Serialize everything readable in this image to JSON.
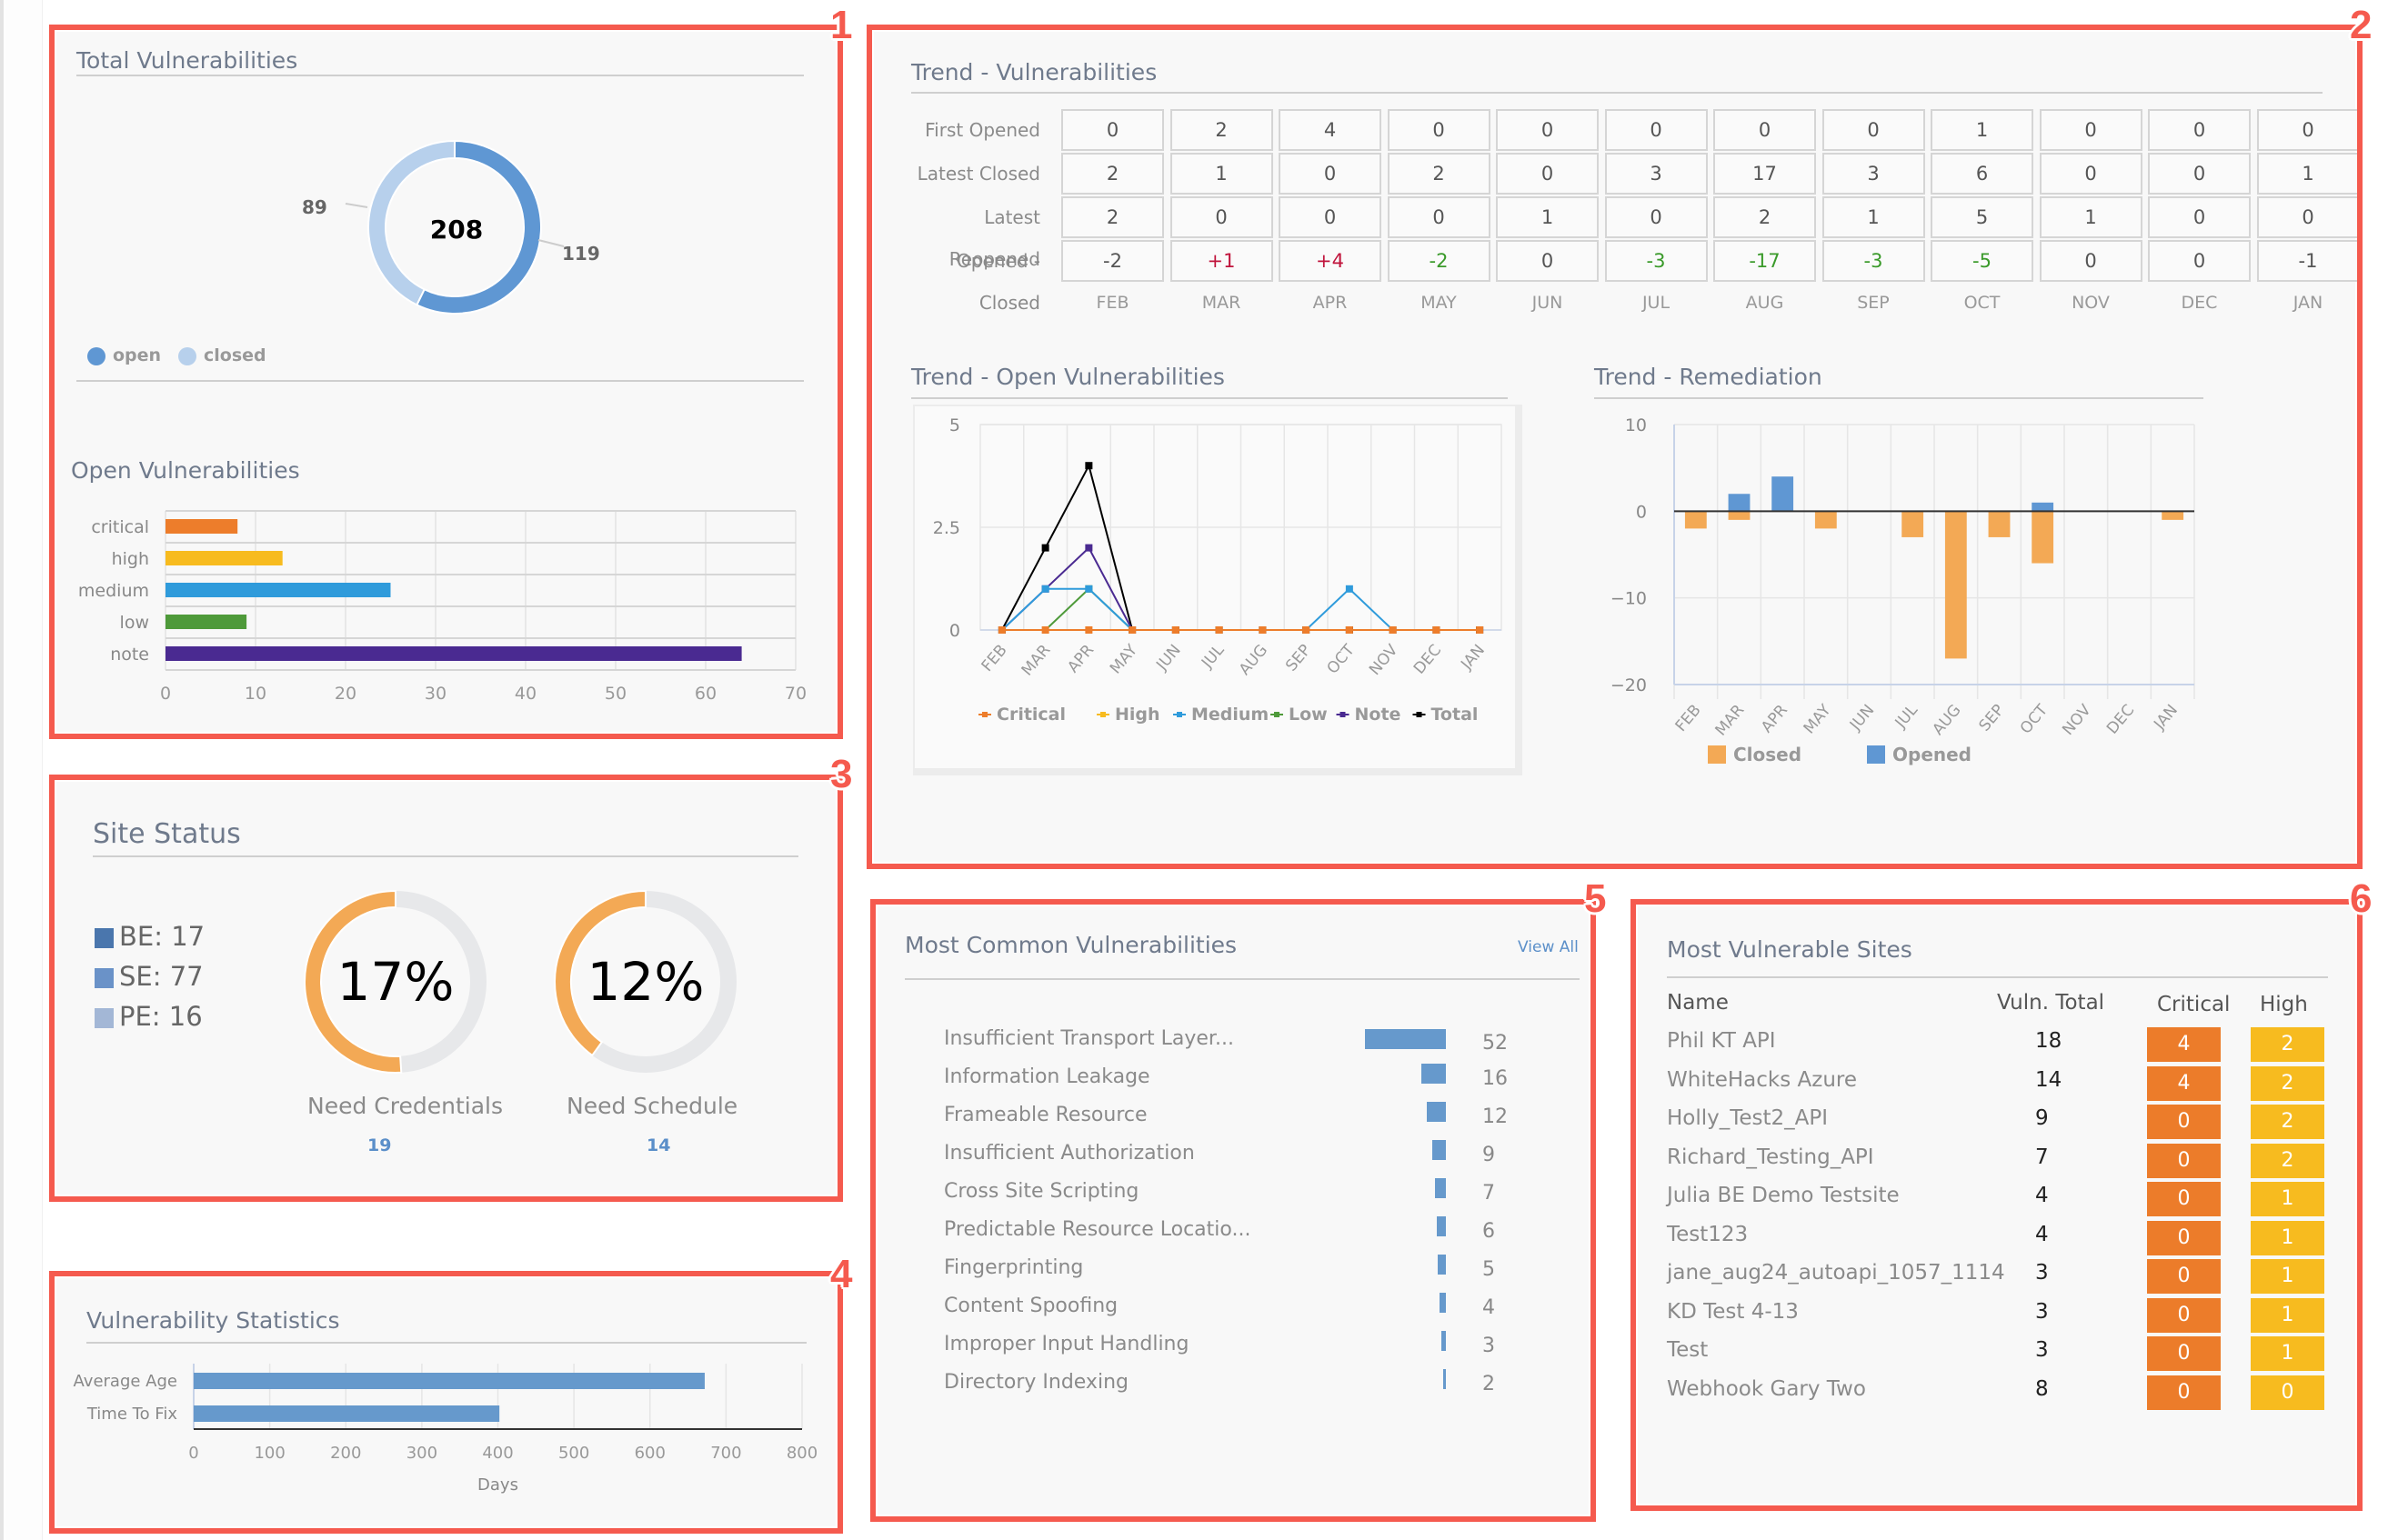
{
  "annotations": [
    "1",
    "2",
    "3",
    "4",
    "5",
    "6"
  ],
  "total_vulnerabilities": {
    "title": "Total Vulnerabilities",
    "total": "208",
    "open": 119,
    "closed": 89,
    "open_label": "119",
    "closed_label": "89",
    "legend": [
      {
        "label": "open",
        "color": "#5f97d3"
      },
      {
        "label": "closed",
        "color": "#b7d0ec"
      }
    ]
  },
  "open_vulnerabilities": {
    "title": "Open Vulnerabilities"
  },
  "trend_vulnerabilities": {
    "title": "Trend - Vulnerabilities",
    "row_labels": [
      "First Opened",
      "Latest Closed",
      "Latest Reopened",
      "Opened - Closed"
    ],
    "months": [
      "FEB",
      "MAR",
      "APR",
      "MAY",
      "JUN",
      "JUL",
      "AUG",
      "SEP",
      "OCT",
      "NOV",
      "DEC",
      "JAN"
    ],
    "first_opened": [
      "0",
      "2",
      "4",
      "0",
      "0",
      "0",
      "0",
      "0",
      "1",
      "0",
      "0",
      "0"
    ],
    "latest_closed": [
      "2",
      "1",
      "0",
      "2",
      "0",
      "3",
      "17",
      "3",
      "6",
      "0",
      "0",
      "1"
    ],
    "latest_reopened": [
      "2",
      "0",
      "0",
      "0",
      "1",
      "0",
      "2",
      "1",
      "5",
      "1",
      "0",
      "0"
    ],
    "opened_minus_closed": [
      "-2",
      "+1",
      "+4",
      "-2",
      "0",
      "-3",
      "-17",
      "-3",
      "-5",
      "0",
      "0",
      "-1"
    ],
    "opened_minus_closed_tone": [
      "neutral",
      "pos",
      "pos",
      "neg",
      "neutral",
      "neg",
      "neg",
      "neg",
      "neg",
      "neutral",
      "neutral",
      "neutral"
    ]
  },
  "trend_open": {
    "title": "Trend - Open Vulnerabilities"
  },
  "trend_remediation": {
    "title": "Trend - Remediation"
  },
  "site_status": {
    "title": "Site Status",
    "legend": [
      {
        "label": "BE: 17",
        "color": "#4a76ad"
      },
      {
        "label": "SE: 77",
        "color": "#6a92c8"
      },
      {
        "label": "PE: 16",
        "color": "#a3b7d6"
      }
    ],
    "gauges": [
      {
        "value": "17%",
        "label": "Need Credentials",
        "count": "19",
        "fill_fraction": 0.51
      },
      {
        "value": "12%",
        "label": "Need Schedule",
        "count": "14",
        "fill_fraction": 0.4
      }
    ],
    "gauge_color": "#f3a955",
    "gauge_track": "#e7e8ea"
  },
  "vulnerability_statistics": {
    "title": "Vulnerability Statistics"
  },
  "most_common": {
    "title": "Most Common Vulnerabilities",
    "view_all": "View All",
    "items": [
      {
        "name": "Insufficient Transport Layer...",
        "count": 52
      },
      {
        "name": "Information Leakage",
        "count": 16
      },
      {
        "name": "Frameable Resource",
        "count": 12
      },
      {
        "name": "Insufficient Authorization",
        "count": 9
      },
      {
        "name": "Cross Site Scripting",
        "count": 7
      },
      {
        "name": "Predictable Resource Locatio...",
        "count": 6
      },
      {
        "name": "Fingerprinting",
        "count": 5
      },
      {
        "name": "Content Spoofing",
        "count": 4
      },
      {
        "name": "Improper Input Handling",
        "count": 3
      },
      {
        "name": "Directory Indexing",
        "count": 2
      }
    ]
  },
  "most_vulnerable_sites": {
    "title": "Most Vulnerable Sites",
    "columns": [
      "Name",
      "Vuln. Total",
      "Critical",
      "High"
    ],
    "rows": [
      {
        "name": "Phil KT API",
        "total": "18",
        "critical": "4",
        "high": "2"
      },
      {
        "name": "WhiteHacks Azure",
        "total": "14",
        "critical": "4",
        "high": "2"
      },
      {
        "name": "Holly_Test2_API",
        "total": "9",
        "critical": "0",
        "high": "2"
      },
      {
        "name": "Richard_Testing_API",
        "total": "7",
        "critical": "0",
        "high": "2"
      },
      {
        "name": "Julia BE Demo Testsite",
        "total": "4",
        "critical": "0",
        "high": "1"
      },
      {
        "name": "Test123",
        "total": "4",
        "critical": "0",
        "high": "1"
      },
      {
        "name": "jane_aug24_autoapi_1057_1114",
        "total": "3",
        "critical": "0",
        "high": "1"
      },
      {
        "name": "KD Test 4-13",
        "total": "3",
        "critical": "0",
        "high": "1"
      },
      {
        "name": "Test",
        "total": "3",
        "critical": "0",
        "high": "1"
      },
      {
        "name": "Webhook Gary Two",
        "total": "8",
        "critical": "0",
        "high": "0"
      }
    ]
  },
  "chart_data": [
    {
      "id": "total-vulnerabilities",
      "type": "pie",
      "title": "Total Vulnerabilities",
      "categories": [
        "open",
        "closed"
      ],
      "values": [
        119,
        89
      ],
      "center_label": "208",
      "legend": "bottom-left"
    },
    {
      "id": "open-vulnerabilities",
      "type": "bar",
      "orientation": "horizontal",
      "title": "Open Vulnerabilities",
      "categories": [
        "critical",
        "high",
        "medium",
        "low",
        "note"
      ],
      "values": [
        8,
        13,
        25,
        9,
        64
      ],
      "colors": [
        "#ed7d2b",
        "#f7bb1f",
        "#2f9bdb",
        "#4e9a3a",
        "#4a2a91"
      ],
      "xlim": [
        0,
        70
      ],
      "xticks": [
        0,
        10,
        20,
        30,
        40,
        50,
        60,
        70
      ],
      "grid": true
    },
    {
      "id": "trend-open-vulnerabilities",
      "type": "line",
      "title": "Trend - Open Vulnerabilities",
      "categories": [
        "FEB",
        "MAR",
        "APR",
        "MAY",
        "JUN",
        "JUL",
        "AUG",
        "SEP",
        "OCT",
        "NOV",
        "DEC",
        "JAN"
      ],
      "series": [
        {
          "name": "Critical",
          "color": "#ed7d2b",
          "values": [
            0,
            0,
            0,
            0,
            0,
            0,
            0,
            0,
            0,
            0,
            0,
            0
          ]
        },
        {
          "name": "High",
          "color": "#f7bb1f",
          "values": [
            0,
            0,
            0,
            0,
            0,
            0,
            0,
            0,
            0,
            0,
            0,
            0
          ]
        },
        {
          "name": "Medium",
          "color": "#2f9bdb",
          "values": [
            0,
            1,
            1,
            0,
            0,
            0,
            0,
            0,
            1,
            0,
            0,
            0
          ]
        },
        {
          "name": "Low",
          "color": "#4e9a3a",
          "values": [
            0,
            0,
            1,
            0,
            0,
            0,
            0,
            0,
            0,
            0,
            0,
            0
          ]
        },
        {
          "name": "Note",
          "color": "#4a2a91",
          "values": [
            0,
            1,
            2,
            0,
            0,
            0,
            0,
            0,
            0,
            0,
            0,
            0
          ]
        },
        {
          "name": "Total",
          "color": "#000000",
          "values": [
            0,
            2,
            4,
            0,
            0,
            0,
            0,
            0,
            0,
            0,
            0,
            0
          ]
        }
      ],
      "ylim": [
        0,
        5
      ],
      "yticks": [
        "0",
        "2.5",
        "5"
      ],
      "grid": true,
      "legend": "bottom"
    },
    {
      "id": "trend-remediation",
      "type": "bar",
      "title": "Trend - Remediation",
      "categories": [
        "FEB",
        "MAR",
        "APR",
        "MAY",
        "JUN",
        "JUL",
        "AUG",
        "SEP",
        "OCT",
        "NOV",
        "DEC",
        "JAN"
      ],
      "series": [
        {
          "name": "Closed",
          "color": "#f3a955",
          "values": [
            -2,
            -1,
            0,
            -2,
            0,
            -3,
            -17,
            -3,
            -6,
            0,
            0,
            -1
          ]
        },
        {
          "name": "Opened",
          "color": "#5f97d3",
          "values": [
            0,
            2,
            4,
            0,
            0,
            0,
            0,
            0,
            1,
            0,
            0,
            0
          ]
        }
      ],
      "ylim": [
        -20,
        10
      ],
      "yticks": [
        "10",
        "0",
        "−10",
        "−20"
      ],
      "grid": true,
      "legend": "bottom"
    },
    {
      "id": "vulnerability-statistics",
      "type": "bar",
      "orientation": "horizontal",
      "title": "Vulnerability Statistics",
      "categories": [
        "Average Age",
        "Time To Fix"
      ],
      "values": [
        672,
        402
      ],
      "color": "#6699cc",
      "xlabel": "Days",
      "xlim": [
        0,
        800
      ],
      "xticks": [
        0,
        100,
        200,
        300,
        400,
        500,
        600,
        700,
        800
      ],
      "grid": true
    },
    {
      "id": "most-common-vulnerabilities",
      "type": "bar",
      "orientation": "horizontal",
      "title": "Most Common Vulnerabilities",
      "categories": [
        "Insufficient Transport Layer...",
        "Information Leakage",
        "Frameable Resource",
        "Insufficient Authorization",
        "Cross Site Scripting",
        "Predictable Resource Locatio...",
        "Fingerprinting",
        "Content Spoofing",
        "Improper Input Handling",
        "Directory Indexing"
      ],
      "values": [
        52,
        16,
        12,
        9,
        7,
        6,
        5,
        4,
        3,
        2
      ],
      "color": "#6699cc"
    }
  ]
}
